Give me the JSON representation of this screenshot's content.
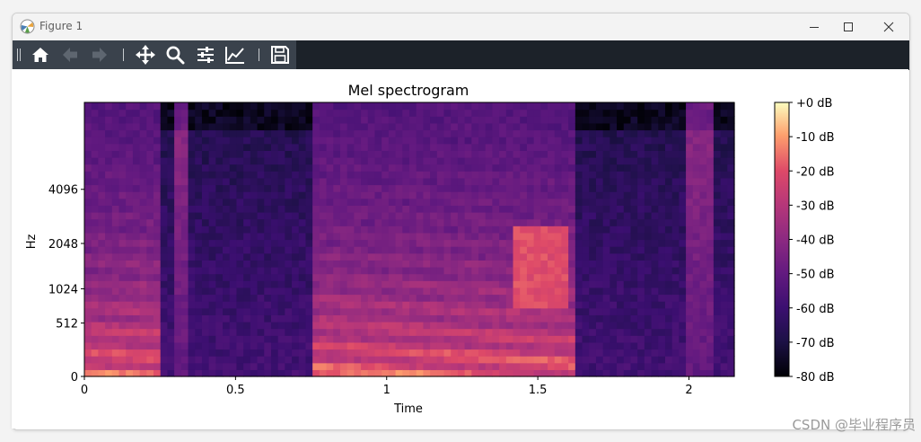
{
  "window": {
    "title": "Figure 1",
    "titlebar_color": "#f3f3f3",
    "toolbar_color": "#1c2229"
  },
  "toolbar": {
    "buttons": [
      {
        "name": "home",
        "icon": "home-icon",
        "enabled": true
      },
      {
        "name": "back",
        "icon": "arrow-left-icon",
        "enabled": false
      },
      {
        "name": "forward",
        "icon": "arrow-right-icon",
        "enabled": false
      },
      {
        "name": "pan",
        "icon": "move-icon",
        "enabled": true
      },
      {
        "name": "zoom",
        "icon": "magnifier-icon",
        "enabled": true
      },
      {
        "name": "configure-subplots",
        "icon": "sliders-icon",
        "enabled": true
      },
      {
        "name": "edit-axis",
        "icon": "line-chart-icon",
        "enabled": true
      },
      {
        "name": "save",
        "icon": "floppy-disk-icon",
        "enabled": true
      }
    ]
  },
  "watermark": "CSDN @毕业程序员",
  "chart_data": {
    "type": "heatmap",
    "title": "Mel spectrogram",
    "xlabel": "Time",
    "ylabel": "Hz",
    "colormap": "magma",
    "xlim": [
      0,
      2.15
    ],
    "x_ticks": [
      0,
      0.5,
      1,
      1.5,
      2
    ],
    "x_tick_labels": [
      "0",
      "0.5",
      "1",
      "1.5",
      "2"
    ],
    "y_ticks_hz": [
      0,
      512,
      1024,
      2048,
      4096
    ],
    "y_tick_labels": [
      "0",
      "512",
      "1024",
      "2048",
      "4096"
    ],
    "colorbar": {
      "range_db": [
        -80,
        0
      ],
      "ticks": [
        0,
        -10,
        -20,
        -30,
        -40,
        -50,
        -60,
        -70,
        -80
      ],
      "tick_labels": [
        "+0 dB",
        "-10 dB",
        "-20 dB",
        "-30 dB",
        "-40 dB",
        "-50 dB",
        "-60 dB",
        "-70 dB",
        "-80 dB"
      ]
    },
    "voiced_segments_s": [
      [
        0.0,
        0.25
      ],
      [
        0.76,
        1.63
      ]
    ],
    "noise_bursts_s": [
      [
        0.3,
        0.35
      ],
      [
        1.98,
        2.07
      ]
    ],
    "background_db": -58
  }
}
